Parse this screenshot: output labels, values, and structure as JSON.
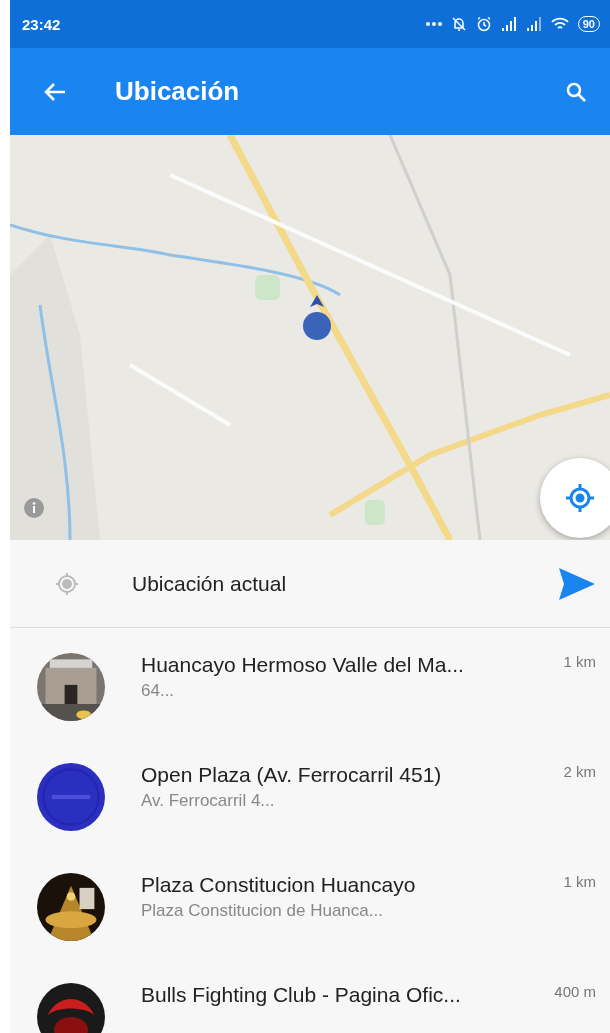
{
  "status_bar": {
    "time": "23:42",
    "battery": "90"
  },
  "app_bar": {
    "title": "Ubicación"
  },
  "current_location": {
    "label": "Ubicación actual"
  },
  "places": [
    {
      "name": "Huancayo Hermoso Valle del Ma...",
      "address": "64...",
      "distance": "1 km"
    },
    {
      "name": "Open Plaza (Av. Ferrocarril 451)",
      "address": "Av. Ferrocarril 4...",
      "distance": "2 km"
    },
    {
      "name": "Plaza Constitucion Huancayo",
      "address": "Plaza Constitucion de Huanca...",
      "distance": "1 km"
    },
    {
      "name": "Bulls Fighting Club - Pagina Ofic...",
      "distance": "400 m"
    }
  ]
}
